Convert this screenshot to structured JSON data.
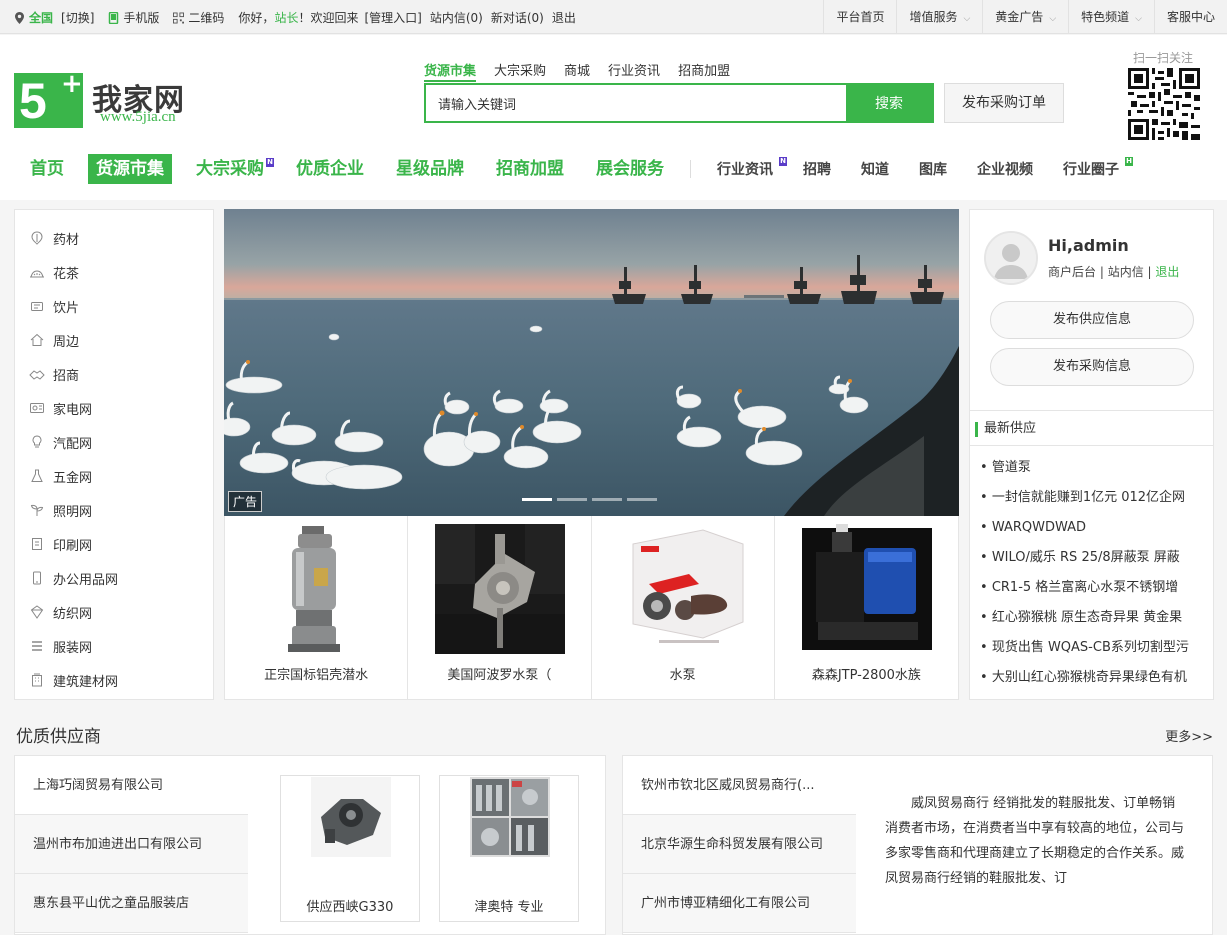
{
  "topbar": {
    "location": "全国",
    "switch": "[切换]",
    "mobile": "手机版",
    "qrcode": "二维码",
    "greeting_pre": "你好，",
    "greeting_name": "站长",
    "greeting_post": "！欢迎回来",
    "admin_entry": "[管理入口]",
    "inbox": "站内信(0)",
    "new_chat": "新对话(0)",
    "logout": "退出",
    "right_items": [
      {
        "label": "平台首页",
        "caret": false
      },
      {
        "label": "增值服务",
        "caret": true
      },
      {
        "label": "黄金广告",
        "caret": true
      },
      {
        "label": "特色频道",
        "caret": true
      },
      {
        "label": "客服中心",
        "caret": false
      }
    ]
  },
  "logo": {
    "five": "5",
    "plus": "+",
    "cn": "我家网",
    "url": "www.5jia.cn"
  },
  "search": {
    "tabs": [
      "货源市集",
      "大宗采购",
      "商城",
      "行业资讯",
      "招商加盟"
    ],
    "active_tab": 0,
    "value": "请输入关键词",
    "button": "搜索",
    "publish": "发布采购订单",
    "qr_label": "扫一扫关注"
  },
  "mainnav": {
    "primary": [
      {
        "label": "首页",
        "badge": ""
      },
      {
        "label": "货源市集",
        "badge": "",
        "active": true
      },
      {
        "label": "大宗采购",
        "badge": "N"
      },
      {
        "label": "优质企业",
        "badge": ""
      },
      {
        "label": "星级品牌",
        "badge": ""
      },
      {
        "label": "招商加盟",
        "badge": ""
      },
      {
        "label": "展会服务",
        "badge": ""
      }
    ],
    "secondary": [
      {
        "label": "行业资讯",
        "badge": "N"
      },
      {
        "label": "招聘",
        "badge": ""
      },
      {
        "label": "知道",
        "badge": ""
      },
      {
        "label": "图库",
        "badge": ""
      },
      {
        "label": "企业视频",
        "badge": ""
      },
      {
        "label": "行业圈子",
        "badge": "H"
      }
    ]
  },
  "categories": [
    {
      "label": "药材",
      "icon": "herb-icon"
    },
    {
      "label": "花茶",
      "icon": "tea-icon"
    },
    {
      "label": "饮片",
      "icon": "slice-icon"
    },
    {
      "label": "周边",
      "icon": "home-icon"
    },
    {
      "label": "招商",
      "icon": "handshake-icon"
    },
    {
      "label": "家电网",
      "icon": "appliance-icon"
    },
    {
      "label": "汽配网",
      "icon": "bulb-icon"
    },
    {
      "label": "五金网",
      "icon": "flask-icon"
    },
    {
      "label": "照明网",
      "icon": "sprout-icon"
    },
    {
      "label": "印刷网",
      "icon": "print-icon"
    },
    {
      "label": "办公用品网",
      "icon": "phone-icon"
    },
    {
      "label": "纺织网",
      "icon": "textile-icon"
    },
    {
      "label": "服装网",
      "icon": "clothing-icon"
    },
    {
      "label": "建筑建材网",
      "icon": "building-icon"
    }
  ],
  "banner": {
    "ad_label": "广告",
    "dots": 4,
    "active_dot": 0
  },
  "products": [
    {
      "name": "正宗国标铝壳潜水"
    },
    {
      "name": "美国阿波罗水泵（"
    },
    {
      "name": "水泵"
    },
    {
      "name": "森森JTP-2800水族"
    }
  ],
  "user": {
    "hi": "Hi,admin",
    "backend": "商户后台",
    "inbox": "站内信",
    "logout": "退出",
    "btn_supply": "发布供应信息",
    "btn_purchase": "发布采购信息",
    "latest_title": "最新供应",
    "latest": [
      "管道泵",
      "一封信就能赚到1亿元 012亿企网",
      "WARQWDWAD",
      "WILO/威乐 RS 25/8屏蔽泵 屏蔽",
      "CR1-5 格兰富离心水泵不锈钢增",
      "红心猕猴桃 原生态奇异果 黄金果",
      "现货出售 WQAS-CB系列切割型污",
      "大别山红心猕猴桃奇异果绿色有机"
    ]
  },
  "suppliers": {
    "title": "优质供应商",
    "more": "更多>>",
    "left_list": [
      "上海巧阔贸易有限公司",
      "温州市布加迪进出口有限公司",
      "惠东县平山优之童品服装店"
    ],
    "left_products": [
      {
        "name": "供应西峡G330"
      },
      {
        "name": "津奥特 专业"
      }
    ],
    "right_list": [
      "钦州市钦北区威凤贸易商行(...",
      "北京华源生命科贸发展有限公司",
      "广州市博亚精细化工有限公司"
    ],
    "right_desc": "威凤贸易商行 经销批发的鞋服批发、订单畅销消费者市场，在消费者当中享有较高的地位，公司与多家零售商和代理商建立了长期稳定的合作关系。威凤贸易商行经销的鞋服批发、订"
  },
  "colors": {
    "brand_green": "#3ab54a",
    "new_badge": "#5a3cc8"
  }
}
